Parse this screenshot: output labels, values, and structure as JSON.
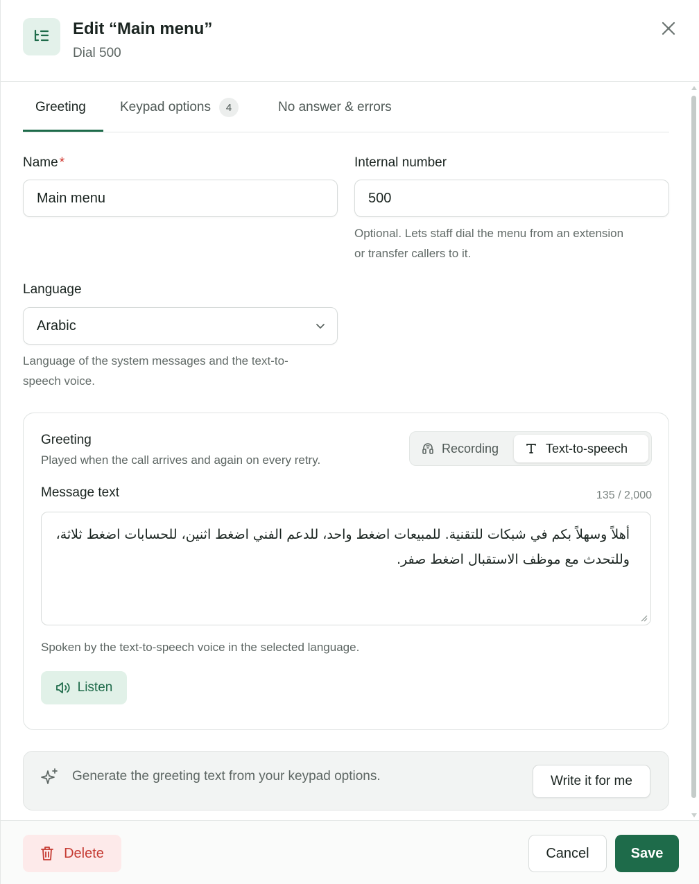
{
  "header": {
    "title": "Edit “Main menu”",
    "subtitle": "Dial 500",
    "icon": "ivr-menu-icon",
    "close_icon": "close-icon"
  },
  "tabs": [
    {
      "label": "Greeting",
      "active": true
    },
    {
      "label": "Keypad options",
      "badge": "4",
      "active": false
    },
    {
      "label": "No answer & errors",
      "active": false
    }
  ],
  "fields": {
    "name": {
      "label": "Name",
      "required_mark": "*",
      "value": "Main menu"
    },
    "internal_number": {
      "label": "Internal number",
      "value": "500",
      "help_line1": "Optional. Lets staff dial the menu from an extension",
      "help_line2": "or transfer callers to it."
    },
    "language": {
      "label": "Language",
      "value": "Arabic",
      "help_line1": "Language of the system messages and the text-to-",
      "help_line2": "speech voice."
    }
  },
  "greeting": {
    "title": "Greeting",
    "description": "Played when the call arrives and again on every retry.",
    "modes": [
      {
        "label": "Recording",
        "icon": "recording-icon",
        "selected": false
      },
      {
        "label": "Text-to-speech",
        "icon": "text-icon",
        "selected": true
      }
    ],
    "message_label": "Message text",
    "counter": "135 / 2,000",
    "message_text": "أهلاً وسهلاً بكم في شبكات للتقنية. للمبيعات اضغط واحد، للدعم الفني اضغط اثنين، للحسابات اضغط ثلاثة، وللتحدث مع موظف الاستقبال اضغط صفر.",
    "help": "Spoken by the text-to-speech voice in the selected language.",
    "listen_label": "Listen"
  },
  "ai_helper": {
    "text": "Generate the greeting text from your keypad options.",
    "button_label": "Write it for me"
  },
  "footer": {
    "delete_label": "Delete",
    "cancel_label": "Cancel",
    "save_label": "Save"
  },
  "colors": {
    "accent": "#1e6b4a",
    "accent_soft": "#e1f1e8",
    "danger": "#c53a32",
    "danger_soft": "#fdeaea",
    "required": "#d0342c"
  }
}
